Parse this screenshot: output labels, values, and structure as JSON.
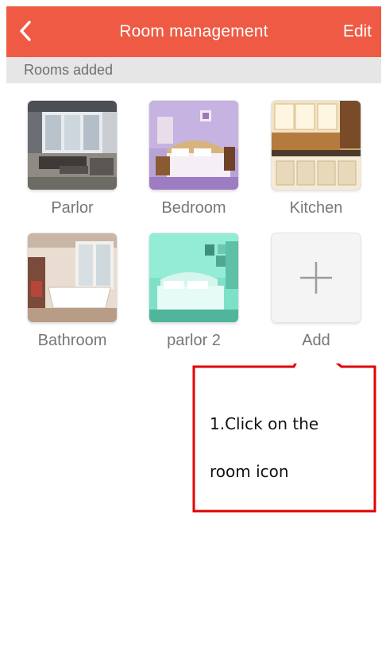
{
  "header": {
    "title": "Room management",
    "edit_label": "Edit",
    "back_icon": "back-arrow-icon",
    "background": "#ee5a43"
  },
  "section": {
    "title": "Rooms added"
  },
  "rooms": [
    {
      "label": "Parlor",
      "image": "living-room-photo"
    },
    {
      "label": "Bedroom",
      "image": "bedroom-photo"
    },
    {
      "label": "Kitchen",
      "image": "kitchen-photo"
    },
    {
      "label": "Bathroom",
      "image": "bathroom-photo"
    },
    {
      "label": "parlor 2",
      "image": "bedroom-teal-photo"
    }
  ],
  "add_tile": {
    "label": "Add",
    "icon": "plus-icon"
  },
  "callout": {
    "line1": "1.Click on the",
    "line2": "room icon",
    "border_color": "#e00000"
  }
}
